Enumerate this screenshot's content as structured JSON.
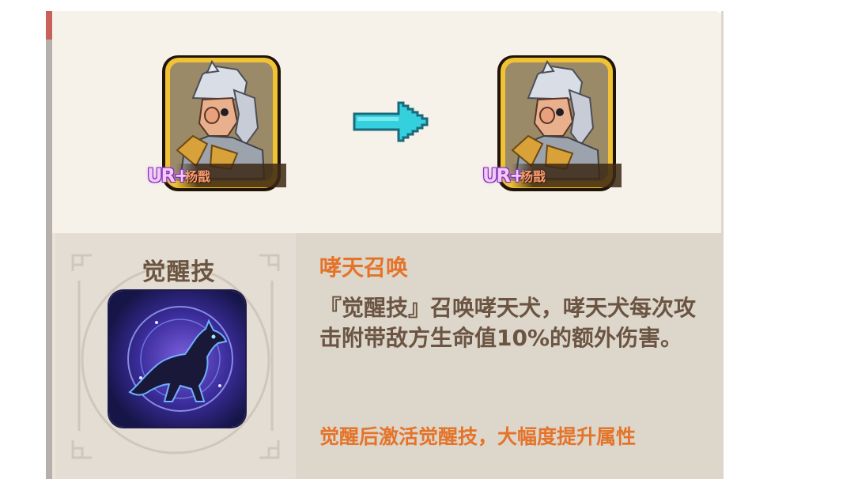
{
  "upgrade": {
    "from_card": {
      "rarity": "UR+",
      "name": "杨戬"
    },
    "to_card": {
      "rarity": "UR+",
      "name": "杨戬"
    },
    "arrow_icon": "right-arrow-icon"
  },
  "awaken_skill": {
    "section_title": "觉醒技",
    "icon": "howling-dog-icon",
    "name": "哮天召唤",
    "description": "『觉醒技』召唤哮天犬，哮天犬每次攻击附带敌方生命值10%的额外伤害。",
    "note": "觉醒后激活觉醒技，大幅度提升属性"
  },
  "colors": {
    "accent": "#e4742a",
    "text": "#6b5542",
    "arrow": "#35d0dd",
    "frame_gold": "#f1c233"
  }
}
